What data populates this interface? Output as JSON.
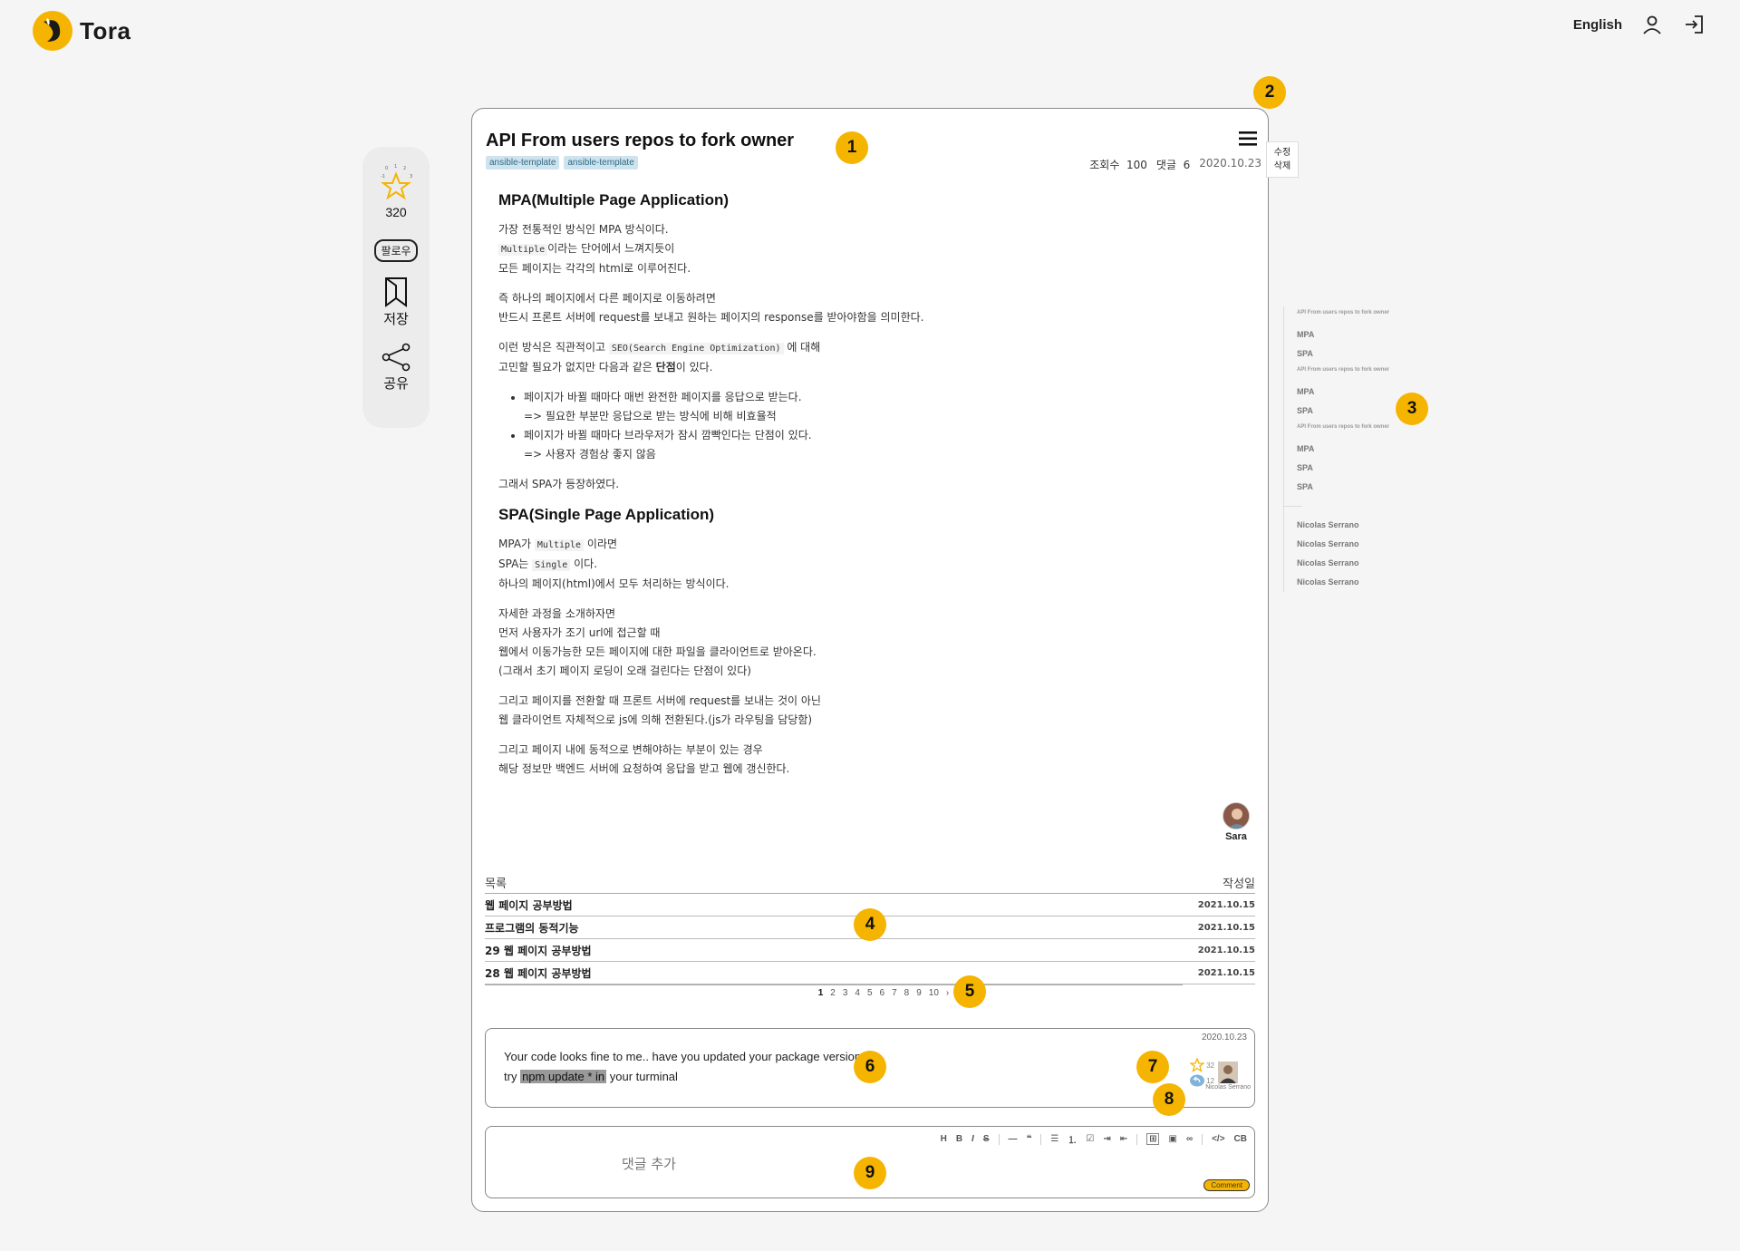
{
  "header": {
    "logo_text": "Tora",
    "language": "English",
    "icons": [
      "user-icon",
      "login-icon"
    ]
  },
  "side": {
    "star_count": "320",
    "follow_label": "팔로우",
    "save_label": "저장",
    "share_label": "공유",
    "star_badges": [
      "0",
      "1",
      "2",
      "-1",
      "3"
    ]
  },
  "post": {
    "title": "API From users repos to fork owner",
    "tags": [
      "ansible-template",
      "ansible-template"
    ],
    "views_label": "조회수",
    "views": "100",
    "comments_label": "댓글",
    "comments": "6",
    "date": "2020.10.23",
    "menu": {
      "edit": "수정",
      "delete": "삭제"
    },
    "author": "Sara"
  },
  "article": {
    "s1_title": "MPA(Multiple Page Application)",
    "p1_l1": "가장 전통적인 방식인 MPA 방식이다.",
    "p1_code": "Multiple",
    "p1_l2": "이라는 단어에서 느껴지듯이",
    "p1_l3": "모든 페이지는 각각의 html로 이루어진다.",
    "p2_l1": "즉 하나의 페이지에서 다른 페이지로 이동하려면",
    "p2_l2": "반드시 프론트 서버에 request를 보내고 원하는 페이지의 response를 받아야함을 의미한다.",
    "p3_a": "이런 방식은 직관적이고",
    "p3_code": "SEO(Search Engine Optimization)",
    "p3_b": "에 대해",
    "p3_c": "고민할 필요가 없지만 다음과 같은",
    "p3_bold": "단점",
    "p3_d": "이 있다.",
    "li1_a": "페이지가 바뀔 때마다 매번 완전한 페이지를 응답으로 받는다.",
    "li1_b": "=> 필요한 부분만 응답으로 받는 방식에 비해 비효율적",
    "li2_a": "페이지가 바뀔 때마다 브라우저가 잠시 깜빡인다는 단점이 있다.",
    "li2_b": "=> 사용자 경험상 좋지 않음",
    "p4": "그래서 SPA가 등장하였다.",
    "s2_title": "SPA(Single Page Application)",
    "p5_a": "MPA가",
    "p5_code1": "Multiple",
    "p5_b": "이라면",
    "p5_c": "SPA는",
    "p5_code2": "Single",
    "p5_d": "이다.",
    "p5_e": "하나의 페이지(html)에서 모두 처리하는 방식이다.",
    "p6_l1": "자세한 과정을 소개하자면",
    "p6_l2": "먼저 사용자가 조기 url에 접근할 때",
    "p6_l3": "웹에서 이동가능한 모든 페이지에 대한 파일을 클라이언트로 받아온다.",
    "p6_l4": "(그래서 초기 페이지 로딩이 오래 걸린다는 단점이 있다)",
    "p7_l1": "그리고 페이지를 전환할 때 프론트 서버에 request를 보내는 것이 아닌",
    "p7_l2": "웹 클라이언트 자체적으로 js에 의해 전환된다.(js가 라우팅을 담당함)",
    "p8_l1": "그리고 페이지 내에 동적으로 변해야하는 부분이 있는 경우",
    "p8_l2": "해당 정보만 백엔드 서버에 요청하여 응답을 받고 웹에 갱신한다."
  },
  "list": {
    "col_title": "목록",
    "col_date": "작성일",
    "rows": [
      {
        "title": "웹 페이지 공부방법",
        "date": "2021.10.15"
      },
      {
        "title": "프로그램의 동적기능",
        "date": "2021.10.15"
      },
      {
        "title": "29 웹 페이지 공부방법",
        "date": "2021.10.15"
      },
      {
        "title": "28 웹 페이지 공부방법",
        "date": "2021.10.15"
      }
    ]
  },
  "pagination": {
    "pages": [
      "1",
      "2",
      "3",
      "4",
      "5",
      "6",
      "7",
      "8",
      "9",
      "10"
    ],
    "current": "1",
    "next": "›"
  },
  "comment": {
    "date": "2020.10.23",
    "line1": "Your code looks fine to me.. have you updated your package version?",
    "line2_a": "try",
    "line2_hl": "npm update * in",
    "line2_b": "your turminal",
    "star_count": "32",
    "reply_count": "12",
    "user": "Nicolas Serrano"
  },
  "editor": {
    "placeholder": "댓글 추가",
    "submit": "Comment",
    "tools": [
      "H",
      "B",
      "I",
      "S",
      "—",
      "❝",
      "☰",
      "⒈",
      "☑",
      "⇥",
      "⇤",
      "⊞",
      "▣",
      "∞",
      "</>",
      "CB"
    ]
  },
  "toc": {
    "groups": [
      {
        "heading": "API From users repos to fork owner",
        "items": [
          "MPA",
          "SPA"
        ]
      },
      {
        "heading": "API From users repos to fork owner",
        "items": [
          "MPA",
          "SPA"
        ]
      },
      {
        "heading": "API From users repos to fork owner",
        "items": [
          "MPA",
          "SPA",
          "SPA"
        ]
      }
    ],
    "users": [
      "Nicolas Serrano",
      "Nicolas Serrano",
      "Nicolas Serrano",
      "Nicolas Serrano"
    ]
  },
  "markers": [
    "1",
    "2",
    "3",
    "4",
    "5",
    "6",
    "7",
    "8",
    "9"
  ],
  "colors": {
    "accent": "#f5b400",
    "tag_bg": "#cfe3ee",
    "tag_text": "#2f6a85"
  }
}
